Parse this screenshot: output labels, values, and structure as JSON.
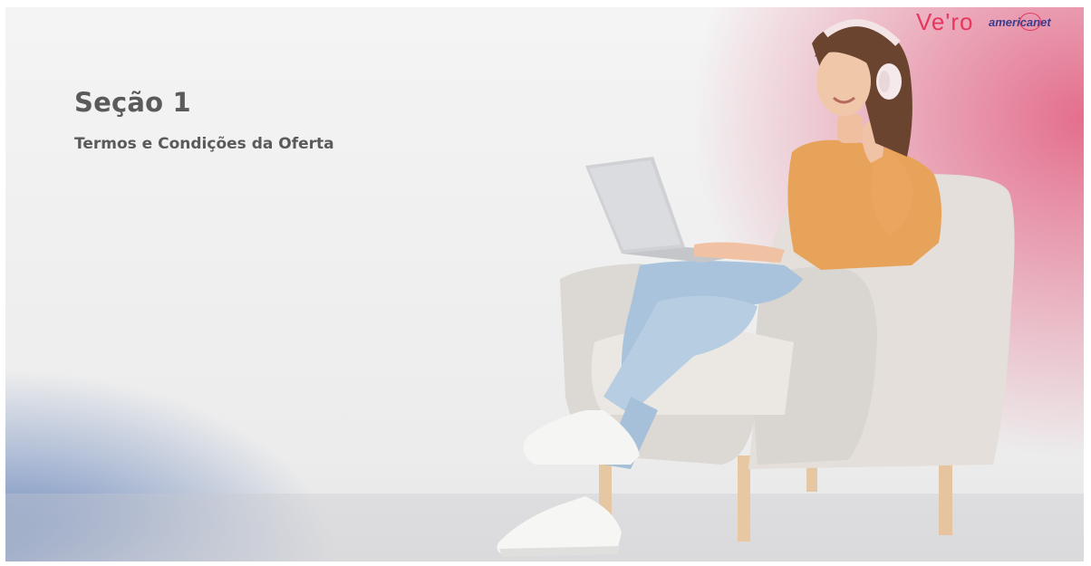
{
  "slide": {
    "title": "Seção 1",
    "subtitle": "Termos e Condições da Oferta"
  },
  "logos": {
    "vero": "Ve'ro",
    "americanet": "americanet"
  },
  "illustration": {
    "subject": "woman-with-headphones-on-armchair-with-laptop",
    "colors": {
      "top_right_accent": "#e26082",
      "bottom_left_accent": "#4c70b2",
      "shirt": "#e8a35a",
      "jeans": "#a9c3dc",
      "armchair": "#e7e3df"
    }
  }
}
